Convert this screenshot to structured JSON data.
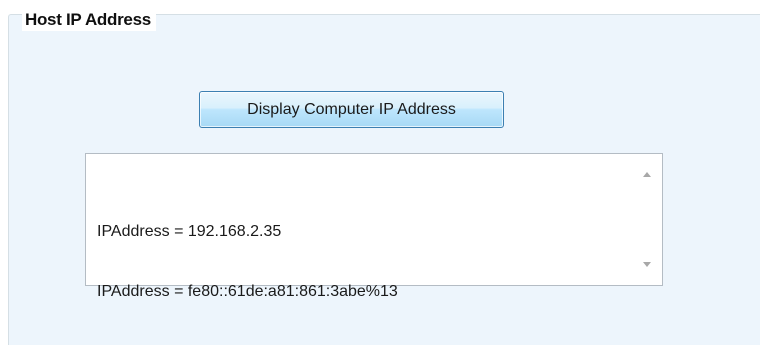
{
  "group": {
    "title": "Host IP Address"
  },
  "button": {
    "label": "Display Computer IP Address"
  },
  "output": {
    "lines": [
      "IPAddress = 192.168.2.35",
      "IPAddress = fe80::61de:a81:861:3abe%13"
    ]
  },
  "icons": {
    "scroll_up": "scroll-up-arrow-icon",
    "scroll_down": "scroll-down-arrow-icon"
  },
  "colors": {
    "panel_background": "#edf5fc",
    "button_border": "#3c7fb1",
    "button_gradient_top": "#eaf6fd",
    "button_gradient_bottom": "#a7d9f5"
  }
}
